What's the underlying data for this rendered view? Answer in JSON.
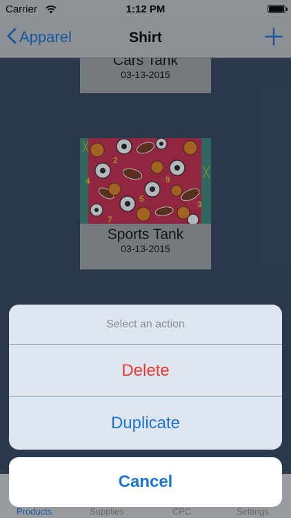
{
  "status_bar": {
    "carrier": "Carrier",
    "time": "1:12 PM",
    "wifi_icon": "wifi-icon",
    "battery_icon": "battery-icon"
  },
  "nav": {
    "back_label": "Apparel",
    "title": "Shirt",
    "add_icon": "plus-icon",
    "back_icon": "chevron-left-icon"
  },
  "products": [
    {
      "name": "Cars Tank",
      "date": "03-13-2015"
    },
    {
      "name": "Sports Tank",
      "date": "03-13-2015"
    }
  ],
  "action_sheet": {
    "title": "Select an action",
    "actions": [
      {
        "label": "Delete",
        "style": "destructive"
      },
      {
        "label": "Duplicate",
        "style": "default"
      }
    ],
    "cancel_label": "Cancel"
  },
  "tab_bar": {
    "tabs": [
      {
        "label": "Products",
        "active": true
      },
      {
        "label": "Supplies",
        "active": false
      },
      {
        "label": "CPC",
        "active": false
      },
      {
        "label": "Settings",
        "active": false
      }
    ]
  },
  "colors": {
    "accent": "#1a74d6",
    "destructive": "#e53a35",
    "background": "#36475c"
  }
}
